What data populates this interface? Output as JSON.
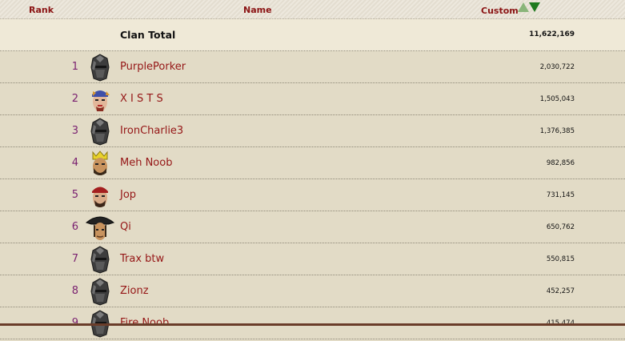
{
  "header": {
    "rank_label": "Rank",
    "name_label": "Name",
    "custom_label": "Custom",
    "sort_up_icon": "sort-ascending-icon",
    "sort_down_icon": "sort-descending-icon"
  },
  "total": {
    "label": "Clan Total",
    "value": "11,622,169"
  },
  "rows": [
    {
      "rank": "1",
      "name": "PurplePorker",
      "value": "2,030,722",
      "avatar": "helmet"
    },
    {
      "rank": "2",
      "name": "X I S T S",
      "value": "1,505,043",
      "avatar": "bandana-blue"
    },
    {
      "rank": "3",
      "name": "IronCharlie3",
      "value": "1,376,385",
      "avatar": "helmet"
    },
    {
      "rank": "4",
      "name": "Meh Noob",
      "value": "982,856",
      "avatar": "crown"
    },
    {
      "rank": "5",
      "name": "Jop",
      "value": "731,145",
      "avatar": "bandana-red"
    },
    {
      "rank": "6",
      "name": "Qi",
      "value": "650,762",
      "avatar": "pirate-hat"
    },
    {
      "rank": "7",
      "name": "Trax btw",
      "value": "550,815",
      "avatar": "helmet"
    },
    {
      "rank": "8",
      "name": "Zionz",
      "value": "452,257",
      "avatar": "helmet"
    },
    {
      "rank": "9",
      "name": "Fire Noob",
      "value": "415,474",
      "avatar": "helmet"
    }
  ],
  "colors": {
    "accent": "#8b1414",
    "rank": "#7a2170",
    "background": "#e2dbc6",
    "total_background": "#efe9d7"
  }
}
